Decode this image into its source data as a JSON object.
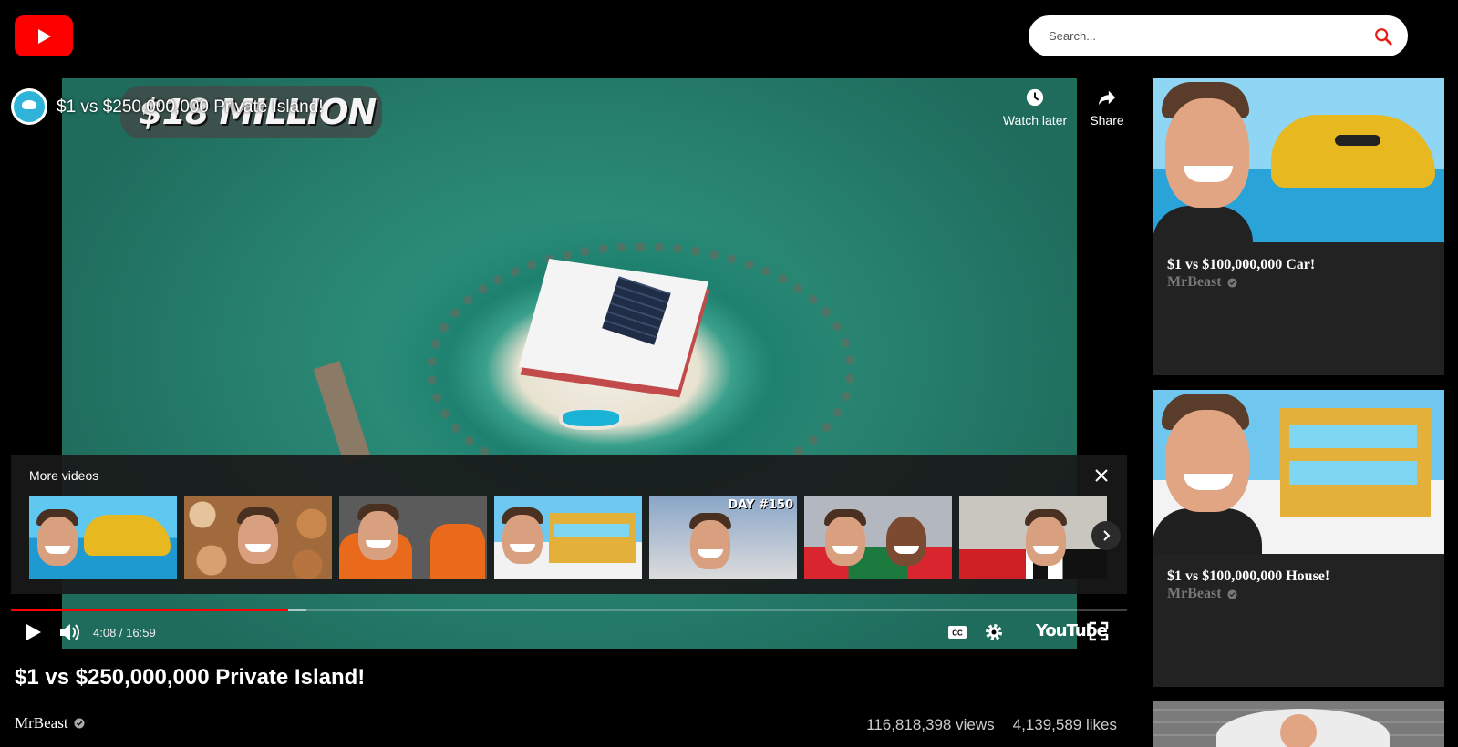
{
  "search": {
    "placeholder": "Search..."
  },
  "player": {
    "title": "$1 vs $250,000,000 Private Island!",
    "thumbnail_badge": "$18 MILLION",
    "watch_later_label": "Watch later",
    "share_label": "Share",
    "more_videos_label": "More videos",
    "more_videos_thumb_text": "DAY #150",
    "time": "4:08 / 16:59",
    "progress_fraction": 0.248,
    "buffered_fraction": 0.265,
    "youtube_label": "YouTube"
  },
  "video": {
    "title": "$1 vs $250,000,000 Private Island!",
    "channel": "MrBeast",
    "views": "116,818,398 views",
    "likes": "4,139,589 likes"
  },
  "sidebar": {
    "items": [
      {
        "title": "$1 vs $100,000,000 Car!",
        "channel": "MrBeast"
      },
      {
        "title": "$1 vs $100,000,000 House!",
        "channel": "MrBeast"
      }
    ]
  },
  "colors": {
    "brand": "#ff0000",
    "card_bg": "#222222",
    "channel_muted": "#777777"
  }
}
